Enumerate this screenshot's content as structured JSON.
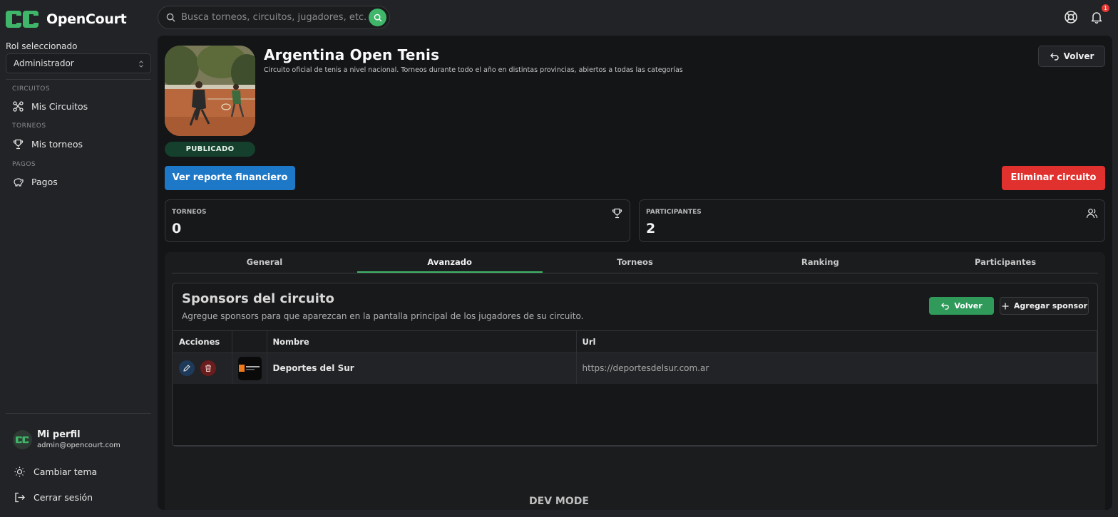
{
  "app": {
    "name": "OpenCourt",
    "search_placeholder": "Busca torneos, circuitos, jugadores, etc.",
    "notification_count": "1"
  },
  "sidebar": {
    "role_label": "Rol seleccionado",
    "role_value": "Administrador",
    "sections": [
      {
        "title": "CIRCUITOS",
        "item": "Mis Circuitos",
        "icon": "circuit-icon"
      },
      {
        "title": "TORNEOS",
        "item": "Mis torneos",
        "icon": "trophy-icon"
      },
      {
        "title": "PAGOS",
        "item": "Pagos",
        "icon": "piggy-bank-icon"
      }
    ],
    "profile": {
      "name": "Mi perfil",
      "email": "admin@opencourt.com"
    },
    "theme_label": "Cambiar tema",
    "logout_label": "Cerrar sesión"
  },
  "circuit": {
    "title": "Argentina Open Tenis",
    "description": "Circuito oficial de tenis a nivel nacional. Torneos durante todo el año en distintas provincias, abiertos a todas las categorías",
    "status": "PUBLICADO",
    "back_label": "Volver",
    "report_label": "Ver reporte financiero",
    "delete_label": "Eliminar circuito"
  },
  "stats": [
    {
      "label": "TORNEOS",
      "value": "0",
      "icon": "trophy-icon"
    },
    {
      "label": "PARTICIPANTES",
      "value": "2",
      "icon": "users-icon"
    }
  ],
  "tabs": [
    "General",
    "Avanzado",
    "Torneos",
    "Ranking",
    "Participantes"
  ],
  "active_tab": "Avanzado",
  "sponsors": {
    "title": "Sponsors del circuito",
    "subtitle": "Agregue sponsors para que aparezcan en la pantalla principal de los jugadores de su circuito.",
    "back_label": "Volver",
    "add_label": "Agregar sponsor",
    "columns": [
      "Acciones",
      "",
      "Nombre",
      "Url"
    ],
    "rows": [
      {
        "name": "Deportes del Sur",
        "url": "https://deportesdelsur.com.ar"
      }
    ]
  },
  "footer": {
    "dev_mode": "DEV MODE"
  },
  "colors": {
    "accent_green": "#3fb66a",
    "primary_blue": "#1e78c8",
    "danger_red": "#e0312e",
    "status_green_bg": "#15402d"
  }
}
